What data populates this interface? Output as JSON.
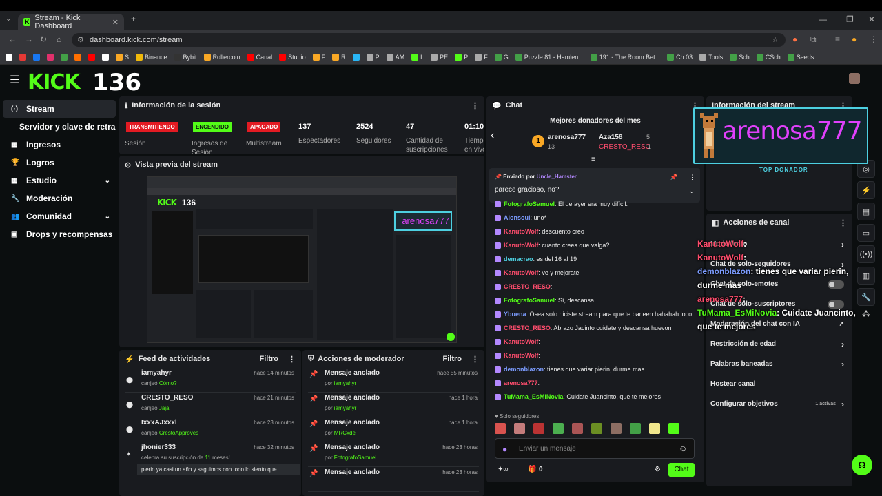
{
  "browser": {
    "tab_title": "Stream - Kick Dashboard",
    "url": "dashboard.kick.com/stream"
  },
  "bookmarks": [
    {
      "label": "",
      "color": "#ffffff"
    },
    {
      "label": "",
      "color": "#e53935"
    },
    {
      "label": "",
      "color": "#1877f2"
    },
    {
      "label": "",
      "color": "#e1306c"
    },
    {
      "label": "",
      "color": "#43a047"
    },
    {
      "label": "",
      "color": "#ff6f00"
    },
    {
      "label": "",
      "color": "#ff0000"
    },
    {
      "label": "",
      "color": "#ffffff"
    },
    {
      "label": "S",
      "color": "#f9a825"
    },
    {
      "label": "Binance",
      "color": "#f0b90b"
    },
    {
      "label": "Bybit",
      "color": "#333333"
    },
    {
      "label": "Rollercoin",
      "color": "#f9a825"
    },
    {
      "label": "Canal",
      "color": "#ff0000"
    },
    {
      "label": "Studio",
      "color": "#ff0000"
    },
    {
      "label": "F",
      "color": "#f9a825"
    },
    {
      "label": "R",
      "color": "#f9a825"
    },
    {
      "label": "",
      "color": "#29b6f6"
    },
    {
      "label": "P",
      "color": "#aaaaaa"
    },
    {
      "label": "AM",
      "color": "#aaaaaa"
    },
    {
      "label": "L",
      "color": "#53fc18"
    },
    {
      "label": "PE",
      "color": "#aaaaaa"
    },
    {
      "label": "P",
      "color": "#53fc18"
    },
    {
      "label": "F",
      "color": "#aaaaaa"
    },
    {
      "label": "G",
      "color": "#43a047"
    },
    {
      "label": "Puzzle 81.- Hamlen...",
      "color": "#43a047"
    },
    {
      "label": "191.- The Room Bet...",
      "color": "#43a047"
    },
    {
      "label": "Ch 03",
      "color": "#43a047"
    },
    {
      "label": "Tools",
      "color": "#aaaaaa"
    },
    {
      "label": "Sch",
      "color": "#43a047"
    },
    {
      "label": "CSch",
      "color": "#43a047"
    },
    {
      "label": "Seeds",
      "color": "#43a047"
    }
  ],
  "header": {
    "logo": "KICK",
    "counter": "136"
  },
  "sidebar": {
    "items": [
      {
        "label": "Stream",
        "icon": "broadcast-icon",
        "active": true
      },
      {
        "label": "Servidor y clave de retransmisión",
        "icon": "",
        "active": false
      },
      {
        "label": "Ingresos",
        "icon": "chart-icon",
        "active": false
      },
      {
        "label": "Logros",
        "icon": "trophy-icon",
        "active": false
      },
      {
        "label": "Estudio",
        "icon": "grid-icon",
        "active": false,
        "chevron": true
      },
      {
        "label": "Moderación",
        "icon": "wrench-icon",
        "active": false
      },
      {
        "label": "Comunidad",
        "icon": "users-icon",
        "active": false,
        "chevron": true
      },
      {
        "label": "Drops y recompensas",
        "icon": "gift-icon",
        "active": false
      }
    ]
  },
  "session": {
    "title": "Información de la sesión",
    "badges": [
      {
        "text": "TRANSMITIENDO",
        "label": "Sesión",
        "color": "#e31b23",
        "textcolor": "#ffffff"
      },
      {
        "text": "ENCENDIDO",
        "label": "Ingresos de Sesión",
        "color": "#53fc18",
        "textcolor": "#0b0e0f"
      },
      {
        "text": "APAGADO",
        "label": "Multistream",
        "color": "#e31b23",
        "textcolor": "#ffffff"
      }
    ],
    "stats": [
      {
        "value": "137",
        "label": "Espectadores"
      },
      {
        "value": "2524",
        "label": "Seguidores"
      },
      {
        "value": "47",
        "label": "Cantidad de suscripciones"
      },
      {
        "value": "01:10:",
        "label": "Tiempo en vivo"
      }
    ]
  },
  "preview": {
    "title": "Vista previa del stream"
  },
  "feed": {
    "title": "Feed de actividades",
    "filter": "Filtro",
    "items": [
      {
        "user": "iamyahyr",
        "time": "hace 14 minutos",
        "action": "canjeó",
        "reward": "Cómo?"
      },
      {
        "user": "CRESTO_RESO",
        "time": "hace 21 minutos",
        "action": "canjeó",
        "reward": "Jaja!"
      },
      {
        "user": "IxxxAJxxxl",
        "time": "hace 23 minutos",
        "action": "canjeó",
        "reward": "CrestoApproves"
      },
      {
        "user": "jhonier333",
        "time": "hace 32 minutos",
        "action": "celebra su suscripción de",
        "months": "11",
        "suffix": "meses!",
        "message": "pierin ya casi un año y seguimos con todo lo siento que"
      }
    ]
  },
  "modactions": {
    "title": "Acciones de moderador",
    "filter": "Filtro",
    "items": [
      {
        "title": "Mensaje anclado",
        "time": "hace 55 minutos",
        "by": "por",
        "user": "iamyahyr"
      },
      {
        "title": "Mensaje anclado",
        "time": "hace 1 hora",
        "by": "por",
        "user": "iamyahyr"
      },
      {
        "title": "Mensaje anclado",
        "time": "hace 1 hora",
        "by": "por",
        "user": "MRCxde"
      },
      {
        "title": "Mensaje anclado",
        "time": "hace 23 horas",
        "by": "por",
        "user": "FotografoSamuel"
      },
      {
        "title": "Mensaje anclado",
        "time": "hace 23 horas",
        "by": "",
        "user": ""
      }
    ]
  },
  "chat": {
    "title": "Chat",
    "donors_title": "Mejores donadores del mes",
    "donor1": {
      "rank": "1",
      "name": "arenosa777",
      "amount": "13"
    },
    "donor2": {
      "name": "Aza158",
      "amount": "5"
    },
    "donor3": {
      "name": "CRESTO_RESO",
      "amount": "1"
    },
    "pinned": {
      "sent_by": "Enviado por",
      "user": "Uncle_Hamster",
      "message": "parece gracioso, no?"
    },
    "messages": [
      {
        "user": "FotografoSamuel",
        "color": "#53fc18",
        "text": ": El de ayer era muy difícil."
      },
      {
        "user": "Alonsoul",
        "color": "#7c9cff",
        "text": ": uno*"
      },
      {
        "user": "KanutoWolf",
        "color": "#ff4d6d",
        "text": ": descuento creo"
      },
      {
        "user": "KanutoWolf",
        "color": "#ff4d6d",
        "text": ": cuanto crees que valga?"
      },
      {
        "user": "demacrao",
        "color": "#4dd0e1",
        "text": ": es del 16 al 19"
      },
      {
        "user": "KanutoWolf",
        "color": "#ff4d6d",
        "text": ": ve y mejorate"
      },
      {
        "user": "CRESTO_RESO",
        "color": "#ff4d6d",
        "text": ":"
      },
      {
        "user": "FotografoSamuel",
        "color": "#53fc18",
        "text": ": Sí, descansa."
      },
      {
        "user": "Ybuena",
        "color": "#7c9cff",
        "text": ": Osea solo hiciste stream para que te baneen hahahah loco"
      },
      {
        "user": "CRESTO_RESO",
        "color": "#ff4d6d",
        "text": ": Abrazo Jacinto cuidate y descansa huevon"
      },
      {
        "user": "KanutoWolf",
        "color": "#ff4d6d",
        "text": ":"
      },
      {
        "user": "KanutoWolf",
        "color": "#ff4d6d",
        "text": ":"
      },
      {
        "user": "demonblazon",
        "color": "#7c9cff",
        "text": ": tienes que variar pierin, durme mas"
      },
      {
        "user": "arenosa777",
        "color": "#ff4d6d",
        "text": ":"
      },
      {
        "user": "TuMama_EsMiNovia",
        "color": "#53fc18",
        "text": ": Cuidate Juancinto, que te mejores"
      }
    ],
    "followers_only": "Solo seguidores",
    "input_placeholder": "Enviar un mensaje",
    "send": "Chat",
    "count": "0"
  },
  "streaminfo": {
    "title": "Información del stream"
  },
  "alert": {
    "name": "arenosa777",
    "label": "TOP DONADOR"
  },
  "channel": {
    "title": "Acciones de canal",
    "items": [
      {
        "label": "Modo lento"
      },
      {
        "label": "Chat de solo-seguidores"
      },
      {
        "label": "Chat de solo-emotes"
      },
      {
        "label": "Chat de solo-suscriptores"
      },
      {
        "label": "Moderación del chat con IA"
      },
      {
        "label": "Restricción de edad"
      },
      {
        "label": "Palabras baneadas"
      },
      {
        "label": "Hostear canal"
      },
      {
        "label": "Configurar objetivos",
        "extra": "1 activas"
      }
    ]
  },
  "overlay": {
    "lines": [
      {
        "user": "KanutoWolf",
        "text": ":",
        "color": "#ff4d6d"
      },
      {
        "user": "KanutoWolf",
        "text": ":",
        "color": "#ff4d6d"
      },
      {
        "user": "demonblazon",
        "text": ": tienes que variar pierin, durme mas",
        "color": "#7c9cff"
      },
      {
        "user": "arenosa777",
        "text": ":",
        "color": "#ff4d6d"
      },
      {
        "user": "TuMama_EsMiNovia",
        "text": ": Cuidate Juancinto, que te mejores",
        "color": "#53fc18"
      }
    ]
  },
  "colors": {
    "kick_green": "#53fc18",
    "live_red": "#e31b23",
    "panel": "#191b1f",
    "bg": "#0b0e0f"
  }
}
